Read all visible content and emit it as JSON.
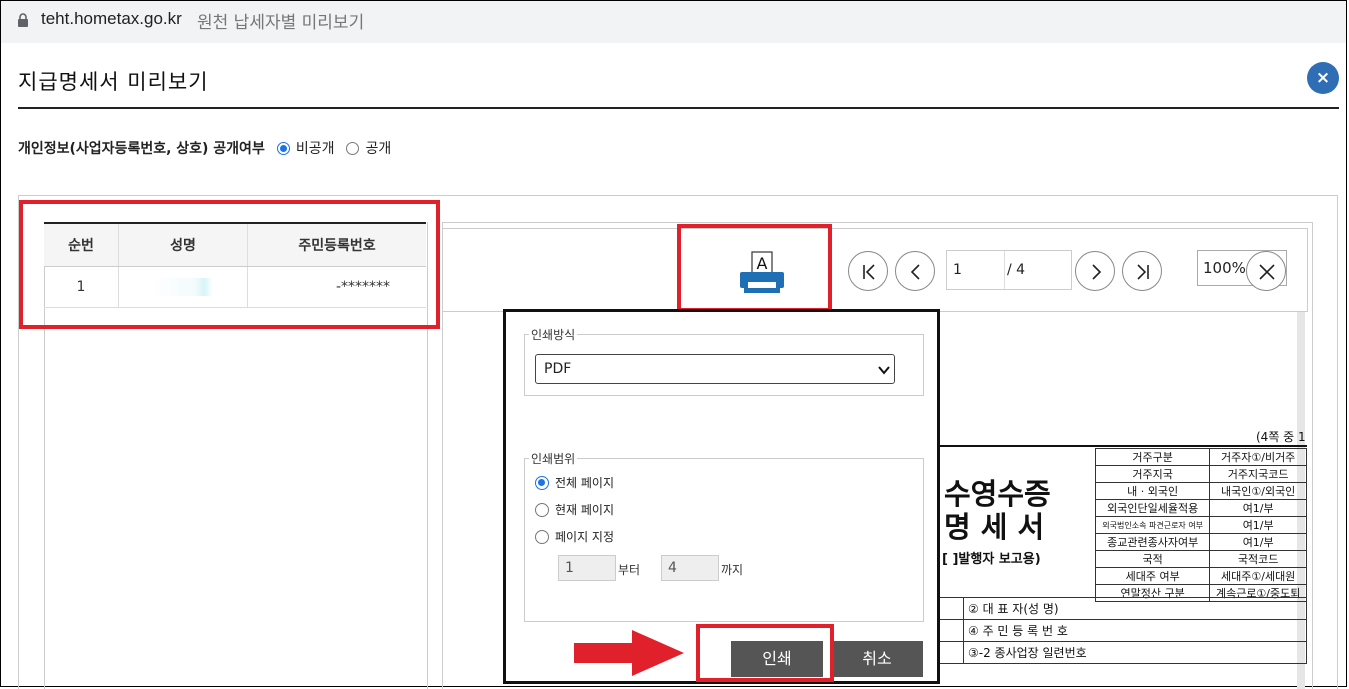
{
  "browser": {
    "host": "teht.hometax.go.kr",
    "page_title": "원천 납세자별 미리보기"
  },
  "modal": {
    "title": "지급명세서 미리보기",
    "close_label": "×"
  },
  "privacy": {
    "label": "개인정보(사업자등록번호, 상호) 공개여부",
    "option_private": "비공개",
    "option_public": "공개",
    "selected": "비공개"
  },
  "table": {
    "headers": [
      "순번",
      "성명",
      "주민등록번호"
    ],
    "rows": [
      {
        "no": "1",
        "name": "",
        "rrn": "-*******"
      }
    ]
  },
  "viewer": {
    "current_page": "1",
    "total_pages": "/ 4",
    "zoom": "100%"
  },
  "document": {
    "page_note": "(4쪽 중 1",
    "title_line1": "수영수증",
    "title_line2": "명 세 서",
    "subtitle": "[     ]발행자 보고용)",
    "grid": [
      [
        "거주구분",
        "거주자①/비거주"
      ],
      [
        "거주지국",
        "거주지국코드"
      ],
      [
        "내 · 외국인",
        "내국인①/외국인"
      ],
      [
        "외국인단일세율적용",
        "여1/부"
      ],
      [
        "외국법인소속 파견근로자 여부",
        "여1/부"
      ],
      [
        "종교관련종사자여부",
        "여1/부"
      ],
      [
        "국적",
        "국적코드"
      ],
      [
        "세대주 여부",
        "세대주①/세대원"
      ],
      [
        "연말정산 구분",
        "계속근로①/중도퇴"
      ]
    ],
    "rows": [
      "② 대 표 자(성   명)",
      "④ 주 민 등 록 번 호",
      "③-2 종사업장 일련번호"
    ]
  },
  "print_dialog": {
    "method_legend": "인쇄방식",
    "method_value": "PDF",
    "range_legend": "인쇄범위",
    "range_all": "전체 페이지",
    "range_current": "현재 페이지",
    "range_custom": "페이지 지정",
    "from_value": "1",
    "from_label": "부터",
    "to_value": "4",
    "to_label": "까지",
    "print_button": "인쇄",
    "cancel_button": "취소"
  },
  "colors": {
    "highlight": "#e0202a",
    "close_button": "#2f6db5",
    "radio_selected": "#1a73e8",
    "print_icon": "#1f6fb5"
  }
}
